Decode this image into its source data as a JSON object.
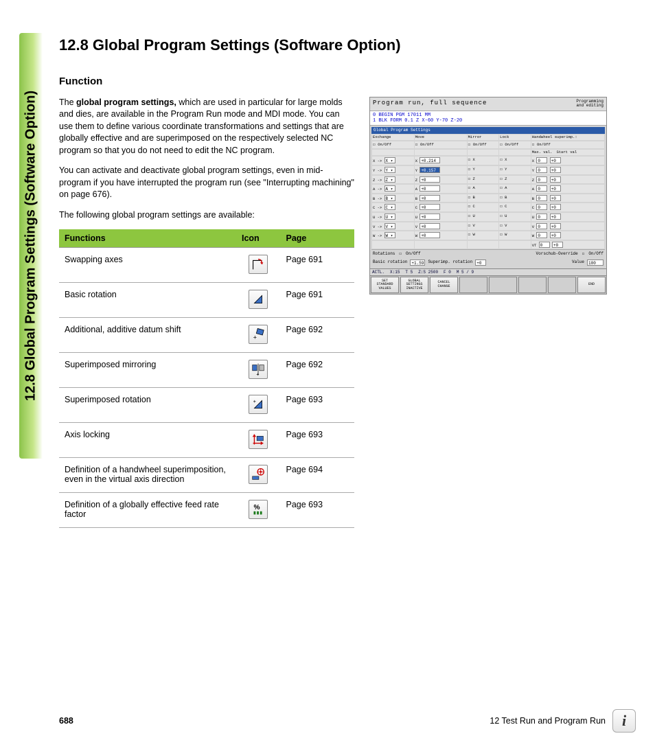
{
  "sideTab": "12.8 Global Program Settings (Software Option)",
  "heading": "12.8  Global Program Settings (Software Option)",
  "subheading": "Function",
  "para1_pre": "The ",
  "para1_bold": "global program settings,",
  "para1_post": " which are used in particular for large molds and dies, are available in the Program Run mode and MDI mode. You can use them to define various coordinate transformations and settings that are globally effective and are superimposed on the respectively selected NC program so that you do not need to edit the NC program.",
  "para2": "You can activate and deactivate global program settings, even in mid-program if you have interrupted the program run (see \"Interrupting machining\" on page 676).",
  "para3": "The following global program settings are available:",
  "table": {
    "headers": {
      "functions": "Functions",
      "icon": "Icon",
      "page": "Page"
    },
    "rows": [
      {
        "fn": "Swapping axes",
        "page": "Page 691"
      },
      {
        "fn": "Basic rotation",
        "page": "Page 691"
      },
      {
        "fn": "Additional, additive datum shift",
        "page": "Page 692"
      },
      {
        "fn": "Superimposed mirroring",
        "page": "Page 692"
      },
      {
        "fn": "Superimposed rotation",
        "page": "Page 693"
      },
      {
        "fn": "Axis locking",
        "page": "Page 693"
      },
      {
        "fn": "Definition of a handwheel superimposition, even in the virtual axis direction",
        "page": "Page 694"
      },
      {
        "fn": "Definition of a globally effective feed rate factor",
        "page": "Page 693"
      }
    ]
  },
  "screenshot": {
    "title_left": "Program run, full sequence",
    "title_right": "Programming\nand editing",
    "prog_line0": "0  BEGIN PGM 17011 MM",
    "prog_line1": "1  BLK FORM 0.1 Z  X-60  Y-70  Z-20",
    "dialog_title": "Global Program Settings",
    "sections": {
      "exchange": "Exchange",
      "move": "Move",
      "mirror": "Mirror",
      "lock": "Lock",
      "handwheel": "Handwheel superimp.:"
    },
    "onoff": "On/Off",
    "axes": [
      "X",
      "Y",
      "Z",
      "A",
      "B",
      "C",
      "U",
      "V",
      "W"
    ],
    "move_vals": [
      "+0.214",
      "+0.157",
      "+0",
      "+0",
      "+0",
      "+0",
      "+0",
      "+0",
      "+0"
    ],
    "hw_cols": {
      "max": "Max. val.",
      "start": "Start val"
    },
    "hw_axes": [
      "X",
      "Y",
      "Z",
      "A",
      "B",
      "C",
      "U",
      "V",
      "W",
      "VT"
    ],
    "rotations_label": "Rotations",
    "basic_rot": "Basic rotation",
    "basic_rot_val": "+1.59",
    "superimp_rot": "Superimp. rotation",
    "superimp_rot_val": "+0",
    "vorschub": "Vorschub-Override",
    "value": "Value",
    "value_val": "100",
    "status": {
      "actl": "ACTL.",
      "x": "X:15",
      "t": "T 5",
      "z": "Z:S 2500",
      "f": "F 0",
      "m": "M 5 / 9"
    },
    "softkeys": [
      "SET\nSTANDARD\nVALUES",
      "GLOBAL\nSETTINGS\nINACTIVE",
      "CANCEL\nCHANGE",
      "",
      "",
      "",
      "",
      "END"
    ]
  },
  "footer": {
    "page_num": "688",
    "chapter": "12 Test Run and Program Run"
  }
}
